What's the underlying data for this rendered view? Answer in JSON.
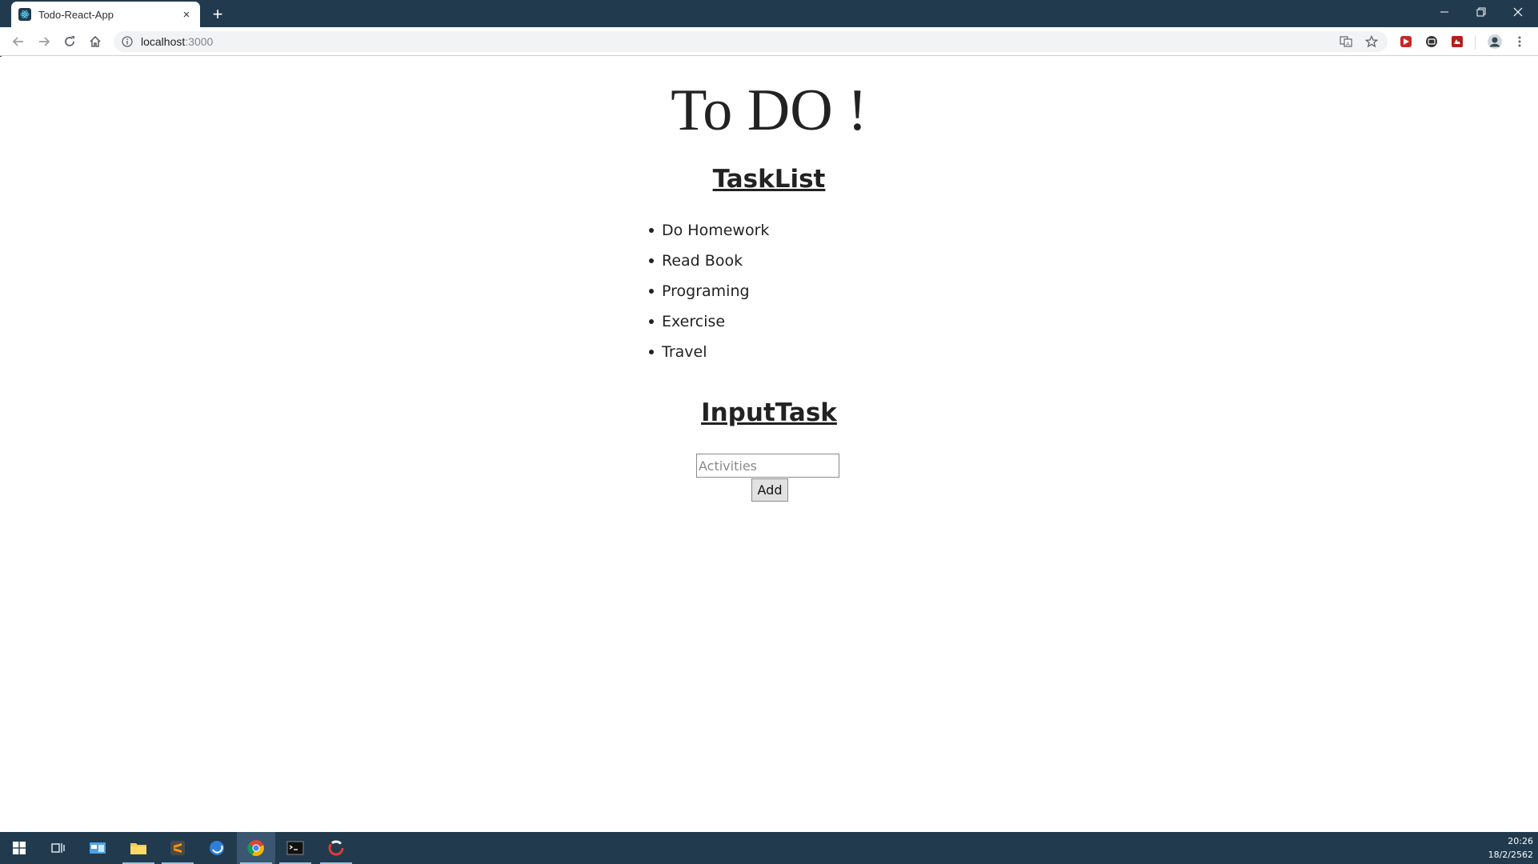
{
  "browser": {
    "tab_title": "Todo-React-App",
    "tab_close_glyph": "×",
    "new_tab_glyph": "+",
    "url_host": "localhost",
    "url_port": ":3000"
  },
  "page": {
    "heading": "To DO !",
    "tasklist_heading": "TaskList",
    "tasks": [
      {
        "label": "Do Homework"
      },
      {
        "label": "Read Book"
      },
      {
        "label": "Programing"
      },
      {
        "label": "Exercise"
      },
      {
        "label": "Travel"
      }
    ],
    "input_heading": "InputTask",
    "input": {
      "placeholder": "Activities",
      "value": ""
    },
    "add_button_label": "Add"
  },
  "taskbar": {
    "time": "20:26",
    "date": "18/2/2562"
  },
  "colors": {
    "chrome_frame": "#213a4e",
    "taskbar": "#213a4e",
    "text": "#222222"
  },
  "icons": [
    "react-favicon-icon",
    "back-icon",
    "forward-icon",
    "reload-icon",
    "home-icon",
    "info-icon",
    "translate-icon",
    "star-icon",
    "extension-icon",
    "profile-avatar-icon",
    "menu-icon",
    "windows-start-icon",
    "task-view-icon",
    "file-explorer-icon",
    "sublime-icon",
    "chrome-icon",
    "terminal-icon"
  ]
}
